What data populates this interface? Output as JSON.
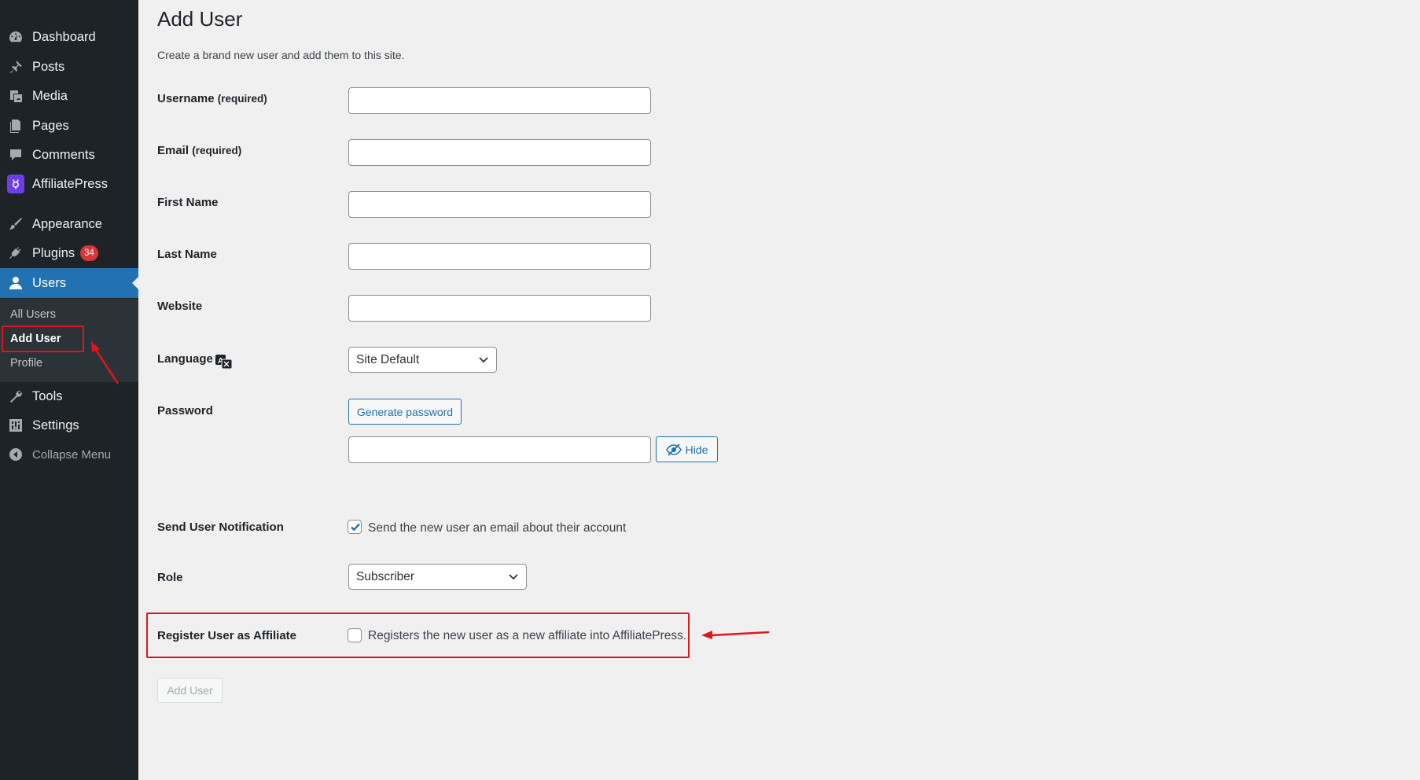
{
  "sidebar": {
    "items": [
      {
        "label": "Dashboard",
        "icon": "dashboard-icon"
      },
      {
        "label": "Posts",
        "icon": "pin-icon"
      },
      {
        "label": "Media",
        "icon": "media-icon"
      },
      {
        "label": "Pages",
        "icon": "pages-icon"
      },
      {
        "label": "Comments",
        "icon": "comment-icon"
      },
      {
        "label": "AffiliatePress",
        "icon": "affiliatepress-logo-icon"
      },
      {
        "label": "Appearance",
        "icon": "brush-icon"
      },
      {
        "label": "Plugins",
        "icon": "plugin-icon",
        "badge": "34"
      },
      {
        "label": "Users",
        "icon": "user-icon"
      },
      {
        "label": "Tools",
        "icon": "wrench-icon"
      },
      {
        "label": "Settings",
        "icon": "settings-icon"
      },
      {
        "label": "Collapse Menu",
        "icon": "collapse-icon"
      }
    ],
    "submenu": [
      "All Users",
      "Add User",
      "Profile"
    ]
  },
  "main": {
    "title": "Add User",
    "description": "Create a brand new user and add them to this site.",
    "fields": {
      "username": {
        "label": "Username",
        "req": "(required)",
        "value": ""
      },
      "email": {
        "label": "Email",
        "req": "(required)",
        "value": ""
      },
      "first_name": {
        "label": "First Name",
        "value": ""
      },
      "last_name": {
        "label": "Last Name",
        "value": ""
      },
      "website": {
        "label": "Website",
        "value": ""
      },
      "language": {
        "label": "Language",
        "selected": "Site Default"
      },
      "password": {
        "label": "Password",
        "generate_label": "Generate password",
        "hide_label": "Hide",
        "value": ""
      },
      "notification": {
        "label": "Send User Notification",
        "checkbox_label": "Send the new user an email about their account",
        "checked": true
      },
      "role": {
        "label": "Role",
        "selected": "Subscriber"
      },
      "affiliate": {
        "label": "Register User as Affiliate",
        "checkbox_label": "Registers the new user as a new affiliate into AffiliatePress.",
        "checked": false
      }
    },
    "submit_label": "Add User"
  },
  "colors": {
    "sidebar_bg": "#1d2327",
    "active_bg": "#2271b1",
    "accent": "#2271b1",
    "annotation": "#e0151b",
    "badge": "#d63638"
  }
}
